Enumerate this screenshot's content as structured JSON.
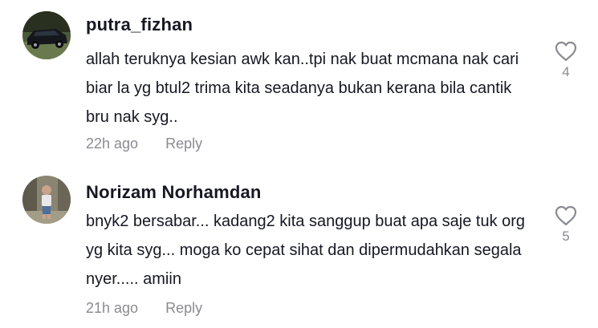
{
  "comments": [
    {
      "username": "putra_fizhan",
      "text": "allah teruknya kesian awk kan..tpi nak buat mcmana nak cari biar la yg btul2 trima kita seadanya bukan kerana bila cantik bru nak syg..",
      "time": "22h ago",
      "reply_label": "Reply",
      "likes": "4"
    },
    {
      "username": "Norizam Norhamdan",
      "text": "bnyk2 bersabar... kadang2 kita sanggup buat apa saje tuk org yg kita syg... moga ko cepat sihat dan dipermudahkan segala nyer..... amiin",
      "time": "21h ago",
      "reply_label": "Reply",
      "likes": "5"
    }
  ],
  "colors": {
    "username": "#161823",
    "meta": "#8a8b91",
    "heart_outline": "#8a8b91"
  }
}
